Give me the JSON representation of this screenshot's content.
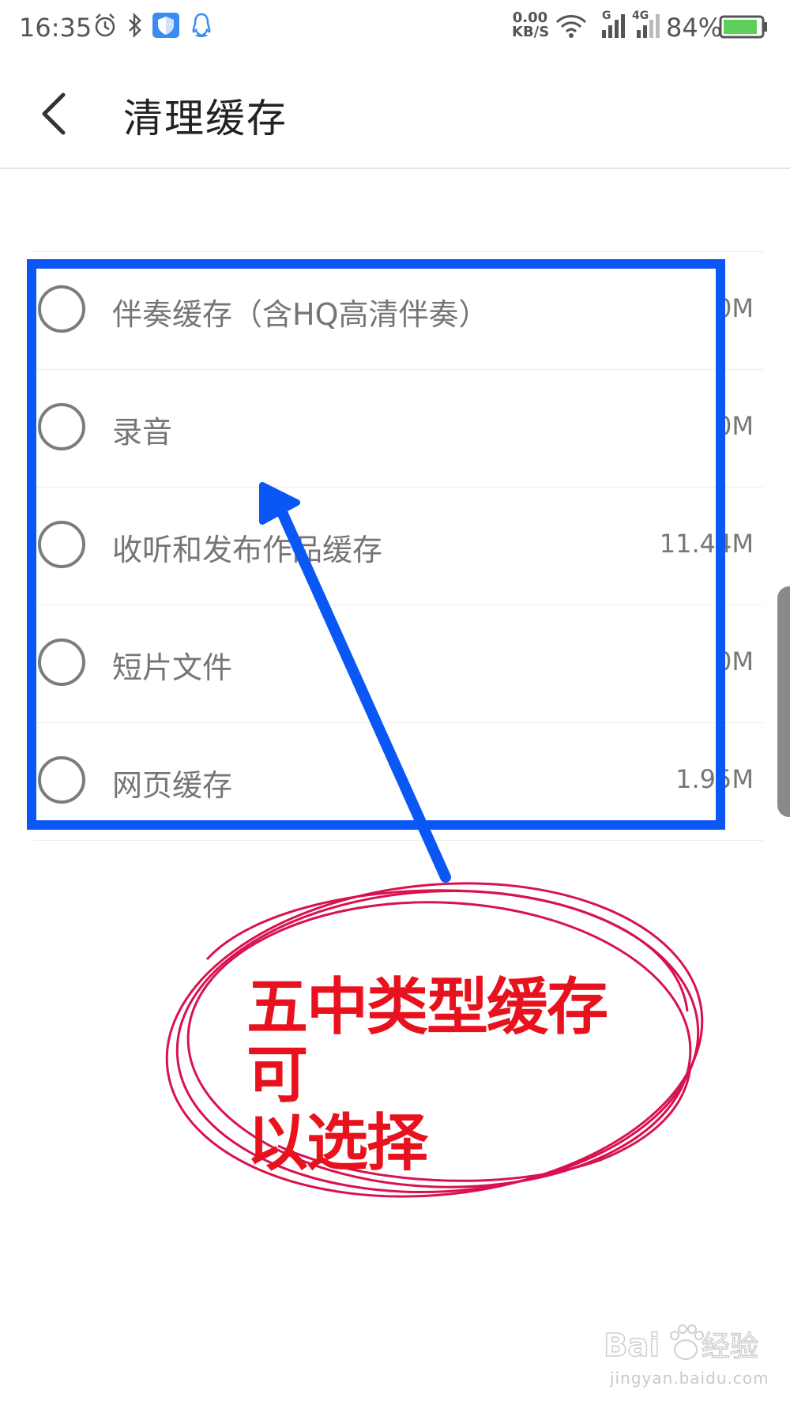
{
  "status_bar": {
    "time": "16:35",
    "net_speed_value": "0.00",
    "net_speed_unit": "KB/S",
    "sim1_label": "G",
    "sim2_label": "4G",
    "battery_percent": "84%",
    "icons": [
      "alarm-icon",
      "bluetooth-icon",
      "shield-icon",
      "qq-icon",
      "wifi-icon",
      "signal-icon",
      "signal-4g-icon",
      "battery-icon"
    ]
  },
  "header": {
    "back_icon": "chevron-left-icon",
    "title": "清理缓存"
  },
  "cache_items": [
    {
      "label": "伴奏缓存（含HQ高清伴奏）",
      "size": "0M"
    },
    {
      "label": "录音",
      "size": "0M"
    },
    {
      "label": "收听和发布作品缓存",
      "size": "11.44M"
    },
    {
      "label": "短片文件",
      "size": "0M"
    },
    {
      "label": "网页缓存",
      "size": "1.95M"
    }
  ],
  "annotation": {
    "text_line1": "五中类型缓存可",
    "text_line2": "以选择",
    "box_color": "#0a57f5",
    "arrow_color": "#0a57f5",
    "text_color": "#e8121e",
    "circle_color": "#d8124f"
  },
  "watermark": {
    "brand": "Baidu经验",
    "url": "jingyan.baidu.com"
  }
}
